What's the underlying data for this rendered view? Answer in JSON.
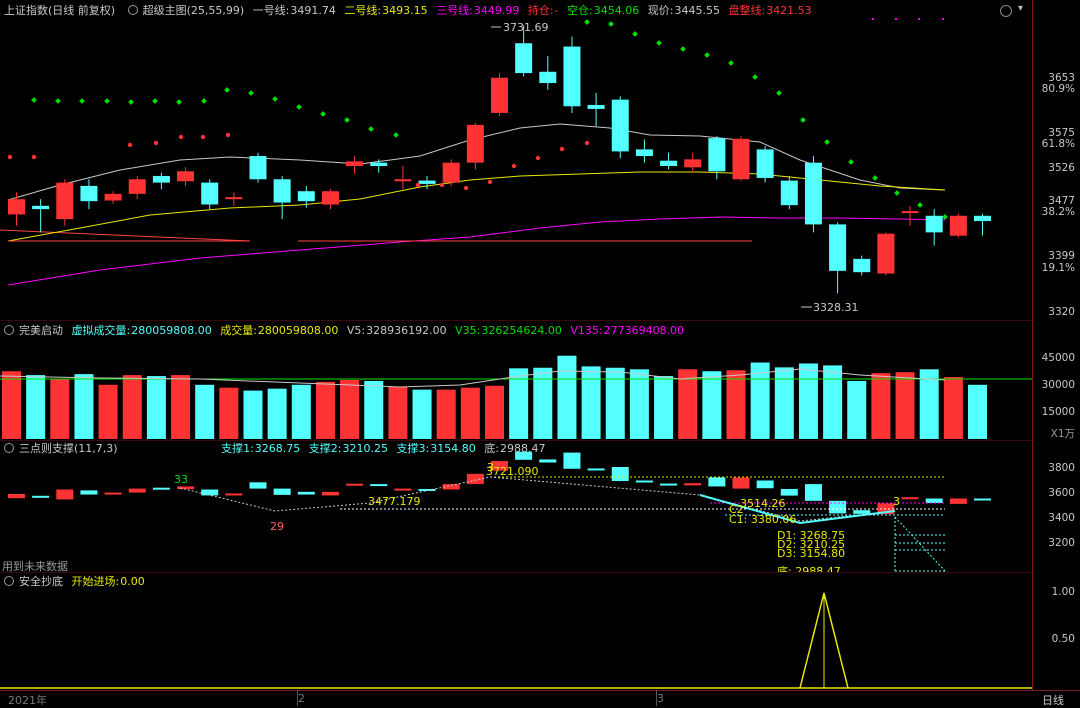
{
  "main_panel": {
    "title": "上证指数(日线 前复权)",
    "indicator": "超级主图(25,55,99)",
    "l1_label": "一号线:",
    "l1_value": "3491.74",
    "l2_label": "二号线:",
    "l2_value": "3493.15",
    "l3_label": "三号线:",
    "l3_value": "3449.99",
    "hold_label": "持仓:",
    "hold_value": "-",
    "empty_label": "空仓:",
    "empty_value": "3454.06",
    "price_label": "现价:",
    "price_value": "3445.55",
    "range_label": "盘整线:",
    "range_value": "3421.53",
    "high_annotation": "3731.69",
    "low_annotation": "3328.31",
    "y_ticks": [
      "3653",
      "80.9%",
      "3575",
      "61.8%",
      "3526",
      "3477",
      "38.2%",
      "3399",
      "19.1%",
      "3320"
    ]
  },
  "volume_panel": {
    "title": "完美启动",
    "vv_label": "虚拟成交量:",
    "vv_value": "280059808.00",
    "vol_label": "成交量:",
    "vol_value": "280059808.00",
    "v5_label": "V5:",
    "v5_value": "328936192.00",
    "v35_label": "V35:",
    "v35_value": "326254624.00",
    "v135_label": "V135:",
    "v135_value": "277369408.00",
    "y_ticks": [
      "45000",
      "30000",
      "15000"
    ],
    "unit": "X1万"
  },
  "support_panel": {
    "title": "三点则支撑(11,7,3)",
    "s1_label": "支撑1:",
    "s1_value": "3268.75",
    "s2_label": "支撑2:",
    "s2_value": "3210.25",
    "s3_label": "支撑3:",
    "s3_value": "3154.80",
    "bottom_label": "底:",
    "bottom_value": "2988.47",
    "footer_note": "用到未来数据",
    "annotations": {
      "n33": "33",
      "n29": "29",
      "n3a": "3",
      "n3b": "3",
      "v3721": "3721.090",
      "v3477": "3477.179",
      "v3514": "3514.26",
      "c1": "C1: 3380.06",
      "c2": "C2",
      "d1": "D1: 3268.75",
      "d2": "D2: 3210.25",
      "d3": "D3: 3154.80",
      "bottom": "底: 2988.47"
    },
    "y_ticks": [
      "3800",
      "3600",
      "3400",
      "3200"
    ]
  },
  "safe_panel": {
    "title": "安全抄底",
    "entry_label": "开始进场:",
    "entry_value": "0.00",
    "y_ticks": [
      "1.00",
      "0.50"
    ]
  },
  "time_axis": {
    "labels": [
      "2021年",
      "2",
      "3"
    ],
    "period_button": "日线"
  },
  "colors": {
    "up": "#ff3333",
    "down": "#54ffff",
    "green_dot": "#00e000",
    "magenta": "#ff00ff",
    "yellow": "#e8e800",
    "white_line": "#c8c8c8"
  },
  "chart_data": {
    "type": "candlestick",
    "candles": [
      [
        3447,
        3470,
        3430,
        3480
      ],
      [
        3460,
        3455,
        3420,
        3470
      ],
      [
        3440,
        3495,
        3430,
        3500
      ],
      [
        3490,
        3467,
        3455,
        3500
      ],
      [
        3468,
        3478,
        3463,
        3482
      ],
      [
        3478,
        3500,
        3470,
        3505
      ],
      [
        3505,
        3495,
        3485,
        3510
      ],
      [
        3497,
        3512,
        3490,
        3518
      ],
      [
        3495,
        3462,
        3455,
        3500
      ],
      [
        3470,
        3473,
        3460,
        3480
      ],
      [
        3535,
        3500,
        3495,
        3540
      ],
      [
        3500,
        3465,
        3440,
        3505
      ],
      [
        3482,
        3467,
        3457,
        3490
      ],
      [
        3462,
        3482,
        3455,
        3485
      ],
      [
        3520,
        3527,
        3508,
        3535
      ],
      [
        3525,
        3520,
        3510,
        3530
      ],
      [
        3500,
        3500,
        3485,
        3520
      ],
      [
        3498,
        3493,
        3485,
        3505
      ],
      [
        3495,
        3525,
        3490,
        3530
      ],
      [
        3525,
        3582,
        3515,
        3585
      ],
      [
        3600,
        3653,
        3595,
        3660
      ],
      [
        3705,
        3660,
        3655,
        3732
      ],
      [
        3662,
        3645,
        3635,
        3686
      ],
      [
        3700,
        3610,
        3600,
        3715
      ],
      [
        3612,
        3606,
        3580,
        3630
      ],
      [
        3620,
        3542,
        3532,
        3625
      ],
      [
        3545,
        3535,
        3525,
        3560
      ],
      [
        3528,
        3520,
        3515,
        3540
      ],
      [
        3518,
        3530,
        3510,
        3540
      ],
      [
        3562,
        3512,
        3500,
        3565
      ],
      [
        3500,
        3561,
        3497,
        3565
      ],
      [
        3545,
        3502,
        3495,
        3550
      ],
      [
        3498,
        3461,
        3455,
        3505
      ],
      [
        3525,
        3432,
        3420,
        3535
      ],
      [
        3432,
        3362,
        3328,
        3435
      ],
      [
        3380,
        3360,
        3355,
        3385
      ],
      [
        3358,
        3418,
        3355,
        3420
      ],
      [
        3452,
        3452,
        3430,
        3460
      ],
      [
        3445,
        3420,
        3400,
        3455
      ],
      [
        3415,
        3445,
        3412,
        3448
      ],
      [
        3445,
        3437,
        3415,
        3448
      ]
    ],
    "volume_wan": [
      35000,
      33000,
      31000,
      33500,
      28000,
      33000,
      32500,
      33000,
      28000,
      26500,
      25000,
      26000,
      28000,
      29500,
      30500,
      30000,
      27000,
      25500,
      25500,
      26500,
      27500,
      36500,
      36800,
      43000,
      37500,
      36800,
      36000,
      32500,
      36000,
      35000,
      35500,
      39500,
      37000,
      39000,
      38000,
      30000,
      34000,
      34500,
      36000,
      32000,
      28000
    ]
  }
}
